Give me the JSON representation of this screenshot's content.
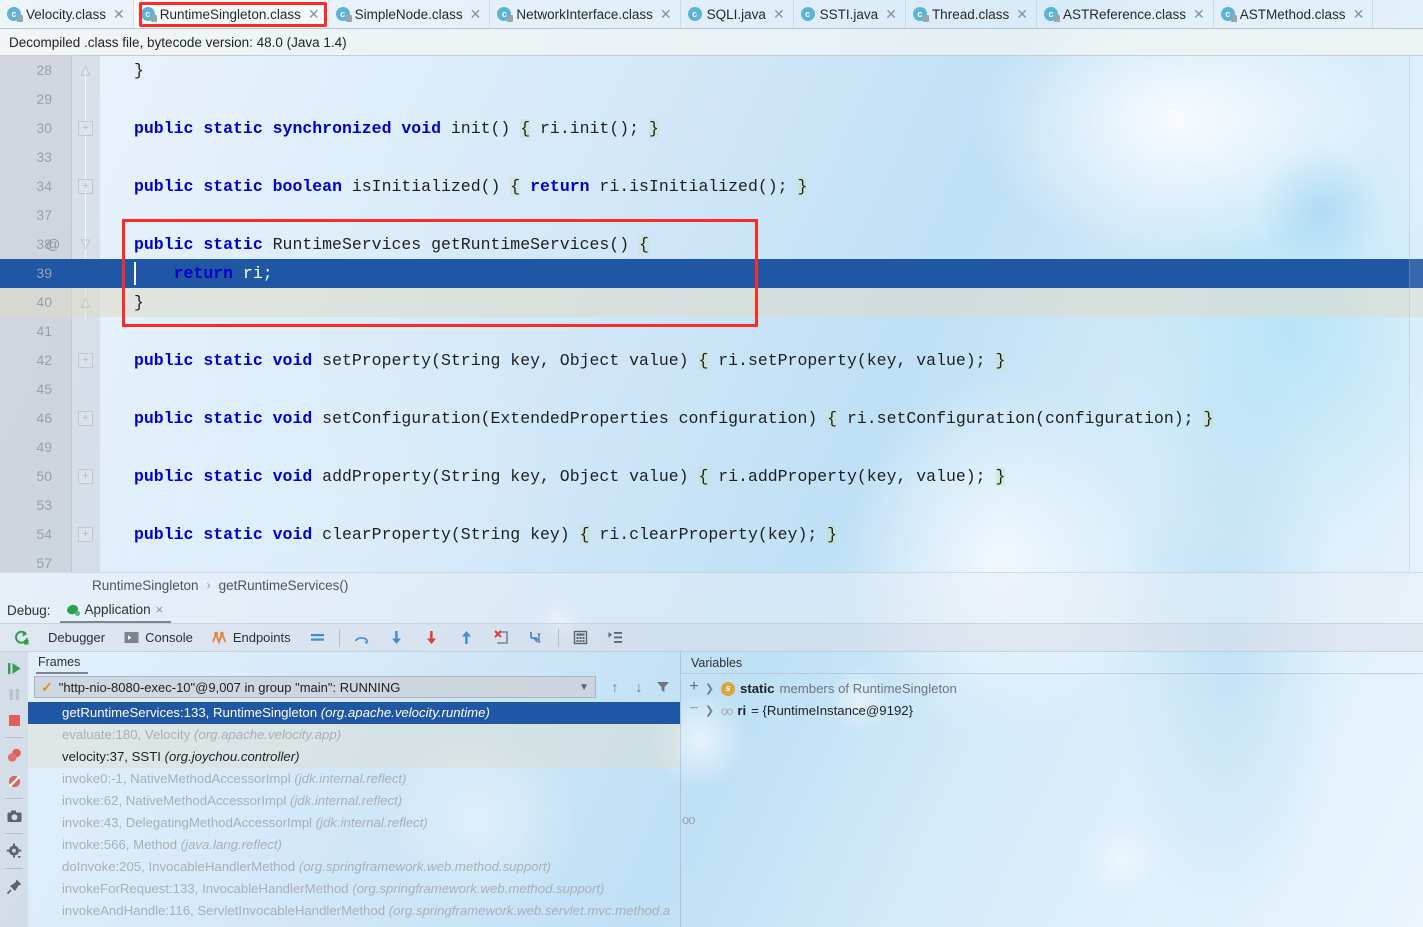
{
  "tabs": [
    {
      "label": "Velocity.class",
      "icon": "java-class-icon",
      "active": false
    },
    {
      "label": "RuntimeSingleton.class",
      "icon": "java-class-icon",
      "active": true
    },
    {
      "label": "SimpleNode.class",
      "icon": "java-class-icon",
      "active": false
    },
    {
      "label": "NetworkInterface.class",
      "icon": "java-class-icon",
      "active": false
    },
    {
      "label": "SQLI.java",
      "icon": "java-file-icon",
      "active": false
    },
    {
      "label": "SSTI.java",
      "icon": "java-file-icon",
      "active": false
    },
    {
      "label": "Thread.class",
      "icon": "java-class-icon",
      "active": false
    },
    {
      "label": "ASTReference.class",
      "icon": "java-class-icon",
      "active": false
    },
    {
      "label": "ASTMethod.class",
      "icon": "java-class-icon",
      "active": false
    }
  ],
  "notification": {
    "text": "Decompiled .class file, bytecode version: 48.0 (Java 1.4)"
  },
  "editor": {
    "lines": [
      {
        "num": "28",
        "fold": "collapse-arrow",
        "at": "",
        "code": "}"
      },
      {
        "num": "29",
        "fold": "",
        "at": "",
        "code": ""
      },
      {
        "num": "30",
        "fold": "plus",
        "at": "",
        "code": "public static synchronized void init() { ri.init(); }"
      },
      {
        "num": "33",
        "fold": "",
        "at": "",
        "code": ""
      },
      {
        "num": "34",
        "fold": "plus",
        "at": "",
        "code": "public static boolean isInitialized() { return ri.isInitialized(); }"
      },
      {
        "num": "37",
        "fold": "",
        "at": "",
        "code": ""
      },
      {
        "num": "38",
        "fold": "minus-arrow",
        "at": "@",
        "code": "public static RuntimeServices getRuntimeServices() {"
      },
      {
        "num": "39",
        "fold": "",
        "at": "",
        "code": "    return ri;"
      },
      {
        "num": "40",
        "fold": "collapse-arrow",
        "at": "",
        "code": "}"
      },
      {
        "num": "41",
        "fold": "",
        "at": "",
        "code": ""
      },
      {
        "num": "42",
        "fold": "plus",
        "at": "",
        "code": "public static void setProperty(String key, Object value) { ri.setProperty(key, value); }"
      },
      {
        "num": "45",
        "fold": "",
        "at": "",
        "code": ""
      },
      {
        "num": "46",
        "fold": "plus",
        "at": "",
        "code": "public static void setConfiguration(ExtendedProperties configuration) { ri.setConfiguration(configuration); }"
      },
      {
        "num": "49",
        "fold": "",
        "at": "",
        "code": ""
      },
      {
        "num": "50",
        "fold": "plus",
        "at": "",
        "code": "public static void addProperty(String key, Object value) { ri.addProperty(key, value); }"
      },
      {
        "num": "53",
        "fold": "",
        "at": "",
        "code": ""
      },
      {
        "num": "54",
        "fold": "plus",
        "at": "",
        "code": "public static void clearProperty(String key) { ri.clearProperty(key); }"
      },
      {
        "num": "57",
        "fold": "",
        "at": "",
        "code": ""
      }
    ],
    "execution_line_number": "39",
    "execution_line_code": "    return ri;",
    "annotation_color": "#fc2b23",
    "selection_color": "#1f57a4"
  },
  "breadcrumb": {
    "class": "RuntimeSingleton",
    "separator": "›",
    "method": "getRuntimeServices()"
  },
  "debug": {
    "label": "Debug:",
    "run_config": "Application",
    "close_label": "×",
    "toolbar": {
      "rerun_icon": "rerun-icon",
      "tabs": [
        {
          "label": "Debugger",
          "icon": "debugger-icon"
        },
        {
          "label": "Console",
          "icon": "console-icon"
        },
        {
          "label": "Endpoints",
          "icon": "endpoints-icon"
        }
      ],
      "buttons": [
        {
          "name": "layout-settings-icon"
        },
        {
          "name": "step-over-icon"
        },
        {
          "name": "step-into-icon"
        },
        {
          "name": "force-step-into-icon"
        },
        {
          "name": "step-out-icon"
        },
        {
          "name": "drop-frame-icon"
        },
        {
          "name": "run-to-cursor-icon"
        },
        {
          "name": "evaluate-expression-icon"
        },
        {
          "name": "show-execution-point-icon"
        }
      ]
    },
    "rail": [
      {
        "name": "resume-program-icon"
      },
      {
        "name": "pause-program-icon"
      },
      {
        "name": "stop-icon"
      },
      {
        "name": "view-breakpoints-icon"
      },
      {
        "name": "mute-breakpoints-icon"
      },
      {
        "name": "screenshot-icon"
      },
      {
        "name": "settings-icon"
      },
      {
        "name": "pin-tab-icon"
      }
    ],
    "frames": {
      "tab_label": "Frames",
      "thread": "\"http-nio-8080-exec-10\"@9,007 in group \"main\": RUNNING",
      "stack": [
        {
          "method": "getRuntimeServices:133, RuntimeSingleton",
          "pkg": "(org.apache.velocity.runtime)",
          "selected": true,
          "dim": false
        },
        {
          "method": "evaluate:180, Velocity",
          "pkg": "(org.apache.velocity.app)",
          "selected": false,
          "dim": true
        },
        {
          "method": "velocity:37, SSTI",
          "pkg": "(org.joychou.controller)",
          "selected": false,
          "dim": false
        },
        {
          "method": "invoke0:-1, NativeMethodAccessorImpl",
          "pkg": "(jdk.internal.reflect)",
          "selected": false,
          "dim": true
        },
        {
          "method": "invoke:62, NativeMethodAccessorImpl",
          "pkg": "(jdk.internal.reflect)",
          "selected": false,
          "dim": true
        },
        {
          "method": "invoke:43, DelegatingMethodAccessorImpl",
          "pkg": "(jdk.internal.reflect)",
          "selected": false,
          "dim": true
        },
        {
          "method": "invoke:566, Method",
          "pkg": "(java.lang.reflect)",
          "selected": false,
          "dim": true
        },
        {
          "method": "doInvoke:205, InvocableHandlerMethod",
          "pkg": "(org.springframework.web.method.support)",
          "selected": false,
          "dim": true
        },
        {
          "method": "invokeForRequest:133, InvocableHandlerMethod",
          "pkg": "(org.springframework.web.method.support)",
          "selected": false,
          "dim": true
        },
        {
          "method": "invokeAndHandle:116, ServletInvocableHandlerMethod",
          "pkg": "(org.springframework.web.servlet.mvc.method.a",
          "selected": false,
          "dim": true
        }
      ]
    },
    "variables": {
      "tab_label": "Variables",
      "rows": [
        {
          "icon": "static-badge",
          "name": "static",
          "value": "members of RuntimeSingleton"
        },
        {
          "icon": "object-badge",
          "name": "ri",
          "value": "= {RuntimeInstance@9192}"
        }
      ]
    }
  }
}
